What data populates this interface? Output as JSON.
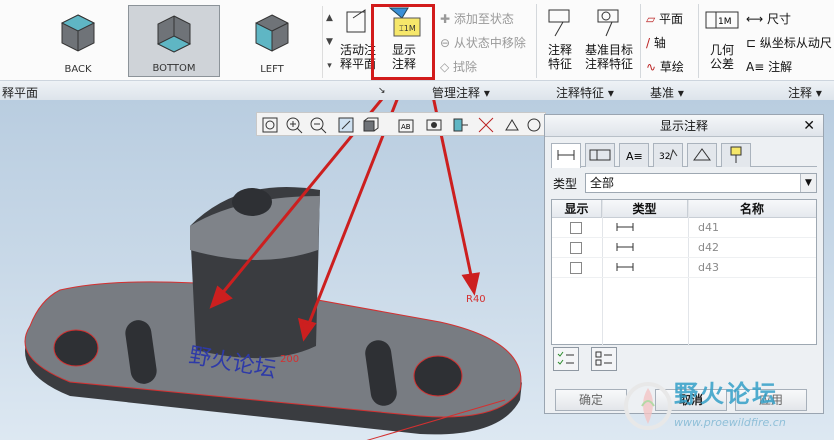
{
  "ribbon": {
    "views": [
      {
        "label": "BACK"
      },
      {
        "label": "BOTTOM"
      },
      {
        "label": "LEFT"
      }
    ],
    "buttons": {
      "active_annotation": "活动注\n释平面",
      "show_annotation": "显示\n注释",
      "add_to_state": "添加至状态",
      "remove_from_state": "从状态中移除",
      "erase": "拭除",
      "annotation_feature": "注释\n特征",
      "datum_target": "基准目标\n注释特征",
      "plane": "平面",
      "axis": "轴",
      "sketch": "草绘",
      "geometric_tolerance": "几何\n公差",
      "dimension": "尺寸",
      "ordinate_dimension": "纵坐标从动尺",
      "note": "注解"
    },
    "groups": {
      "annotation_plane": "释平面",
      "manage_annotation": "管理注释 ▾",
      "annotation_feature": "注释特征 ▾",
      "datum": "基准 ▾",
      "annotation": "注释 ▾"
    }
  },
  "model": {
    "dimension_value": "200",
    "radius_label": "R40"
  },
  "dialog": {
    "title": "显示注释",
    "close": "✕",
    "type_label": "类型",
    "type_value": "全部",
    "columns": {
      "show": "显示",
      "type": "类型",
      "name": "名称"
    },
    "rows": [
      {
        "name": "d41",
        "checked": false
      },
      {
        "name": "d42",
        "checked": false
      },
      {
        "name": "d43",
        "checked": false
      }
    ],
    "ok": "确定",
    "cancel": "取消",
    "apply": "应用"
  },
  "watermark": {
    "title": "野火论坛",
    "url": "www.proewildfire.cn"
  },
  "colors": {
    "highlight": "#d21b1b",
    "arrow": "#cc1f1f",
    "model_fill": "#6f7378"
  }
}
